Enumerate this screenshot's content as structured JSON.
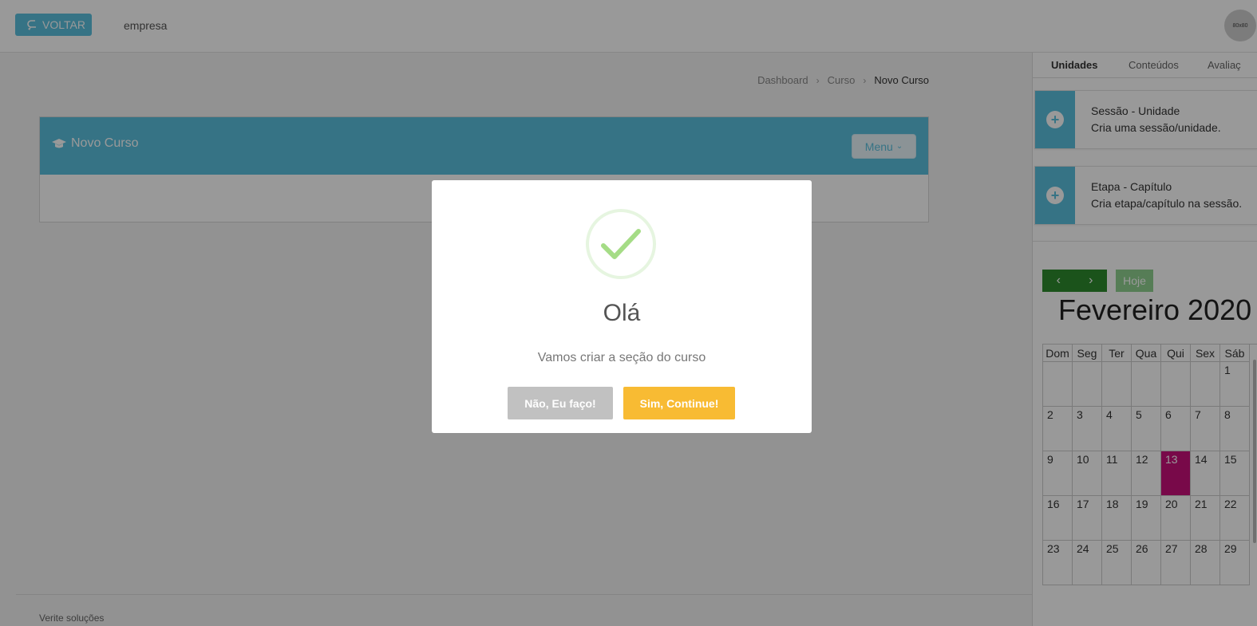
{
  "header": {
    "back_label": "VOLTAR",
    "company": "empresa",
    "avatar_text": "80x80"
  },
  "breadcrumb": [
    "Dashboard",
    "Curso",
    "Novo Curso"
  ],
  "card": {
    "title": "Novo Curso",
    "menu_label": "Menu"
  },
  "footer": {
    "text": "Verite soluções"
  },
  "right_panel": {
    "tabs": [
      "Unidades",
      "Conteúdos",
      "Avaliaç"
    ],
    "items": [
      {
        "title": "Sessão - Unidade",
        "desc": "Cria uma sessão/unidade."
      },
      {
        "title": "Etapa - Capítulo",
        "desc": "Cria etapa/capítulo na sessão."
      }
    ],
    "calendar": {
      "today_label": "Hoje",
      "title": "Fevereiro 2020",
      "weekdays": [
        "Dom",
        "Seg",
        "Ter",
        "Qua",
        "Qui",
        "Sex",
        "Sáb"
      ],
      "weeks": [
        [
          "",
          "",
          "",
          "",
          "",
          "",
          "1"
        ],
        [
          "2",
          "3",
          "4",
          "5",
          "6",
          "7",
          "8"
        ],
        [
          "9",
          "10",
          "11",
          "12",
          "13",
          "14",
          "15"
        ],
        [
          "16",
          "17",
          "18",
          "19",
          "20",
          "21",
          "22"
        ],
        [
          "23",
          "24",
          "25",
          "26",
          "27",
          "28",
          "29"
        ]
      ],
      "highlighted_day": "13"
    }
  },
  "modal": {
    "title": "Olá",
    "text": "Vamos criar a seção do curso",
    "cancel_label": "Não, Eu faço!",
    "confirm_label": "Sim, Continue!"
  },
  "colors": {
    "primary": "#5bc0de",
    "confirm": "#f8bb33",
    "cancel": "#c1c1c1",
    "calendar_nav": "#2e8b2e",
    "today": "#c8107a"
  }
}
